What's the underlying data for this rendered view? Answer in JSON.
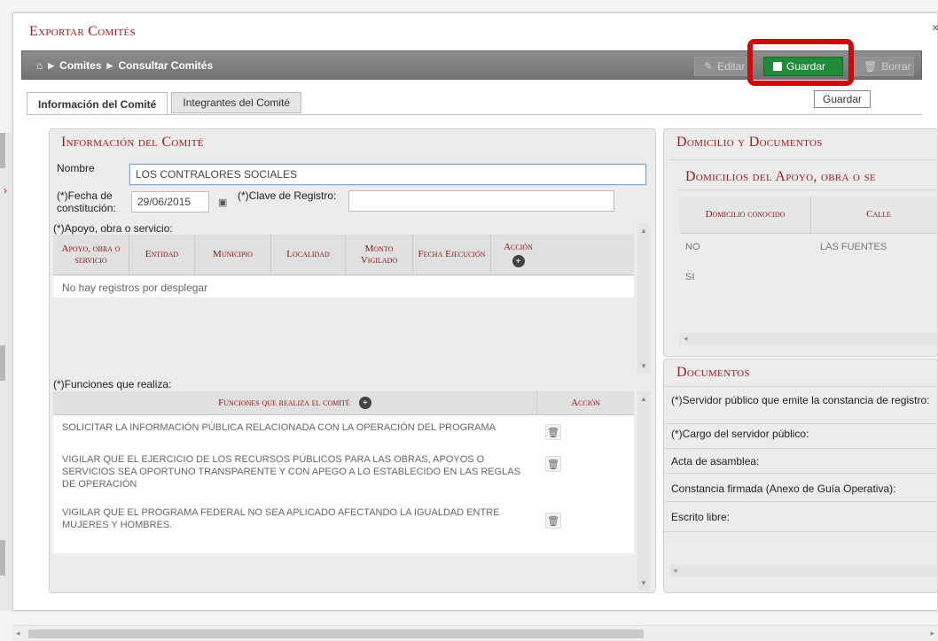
{
  "window": {
    "title": "Exportar Comités",
    "close_icon": "close-icon"
  },
  "breadcrumb": {
    "home_icon": "home-icon",
    "items": [
      "Comites",
      "Consultar Comités"
    ]
  },
  "toolbar": {
    "edit_label": "Editar",
    "save_label": "Guardar",
    "delete_label": "Borrar",
    "save_tooltip": "Guardar"
  },
  "tabs": [
    {
      "label": "Información del Comité",
      "active": true
    },
    {
      "label": "Integrantes del Comité",
      "active": false
    }
  ],
  "info": {
    "title": "Información del Comité",
    "nombre_label": "Nombre",
    "nombre_value": "LOS CONTRALORES SOCIALES",
    "fecha_label_1": "(*)Fecha de",
    "fecha_label_2": "constitución:",
    "fecha_value": "29/06/2015",
    "clave_label": "(*)Clave de Registro:",
    "clave_value": "",
    "apoyo_label": "(*)Apoyo, obra o servicio:",
    "apoyo_columns": [
      "Apoyo, obra o servicio",
      "Entidad",
      "Municipio",
      "Localidad",
      "Monto Vigilado",
      "Fecha Ejecución",
      "Acción"
    ],
    "apoyo_empty": "No hay registros por desplegar",
    "funciones_label": "(*)Funciones que realiza:",
    "funciones_columns": [
      "Funciones que realiza el comité",
      "Acción"
    ],
    "funciones": [
      "SOLICITAR LA INFORMACIÓN PÚBLICA RELACIONADA CON LA OPERACIÓN DEL PROGRAMA",
      "VIGILAR QUE EL EJERCICIO DE LOS RECURSOS PÚBLICOS PARA LAS OBRAS, APOYOS O SERVICIOS SEA OPORTUNO TRANSPARENTE Y CON APEGO A LO ESTABLECIDO EN LAS REGLAS DE OPERACIÓN",
      "VIGILAR QUE EL PROGRAMA FEDERAL NO SEA APLICADO AFECTANDO LA IGUALDAD ENTRE MUJERES Y HOMBRES."
    ]
  },
  "domicilio": {
    "title": "Domicilio y Documentos",
    "subtitle": "Domicilios del Apoyo, obra o se",
    "columns": [
      "Domicilio conocido",
      "Calle"
    ],
    "rows": [
      {
        "domicilio": "NO",
        "calle": "LAS FUENTES"
      },
      {
        "domicilio": "SI",
        "calle": ""
      }
    ]
  },
  "documentos": {
    "title": "Documentos",
    "items": [
      "(*)Servidor público que emite la constancia de registro:",
      "(*)Cargo del servidor público:",
      "Acta de asamblea:",
      "Constancia firmada (Anexo de Guía Operativa):",
      "Escrito libre:"
    ]
  }
}
